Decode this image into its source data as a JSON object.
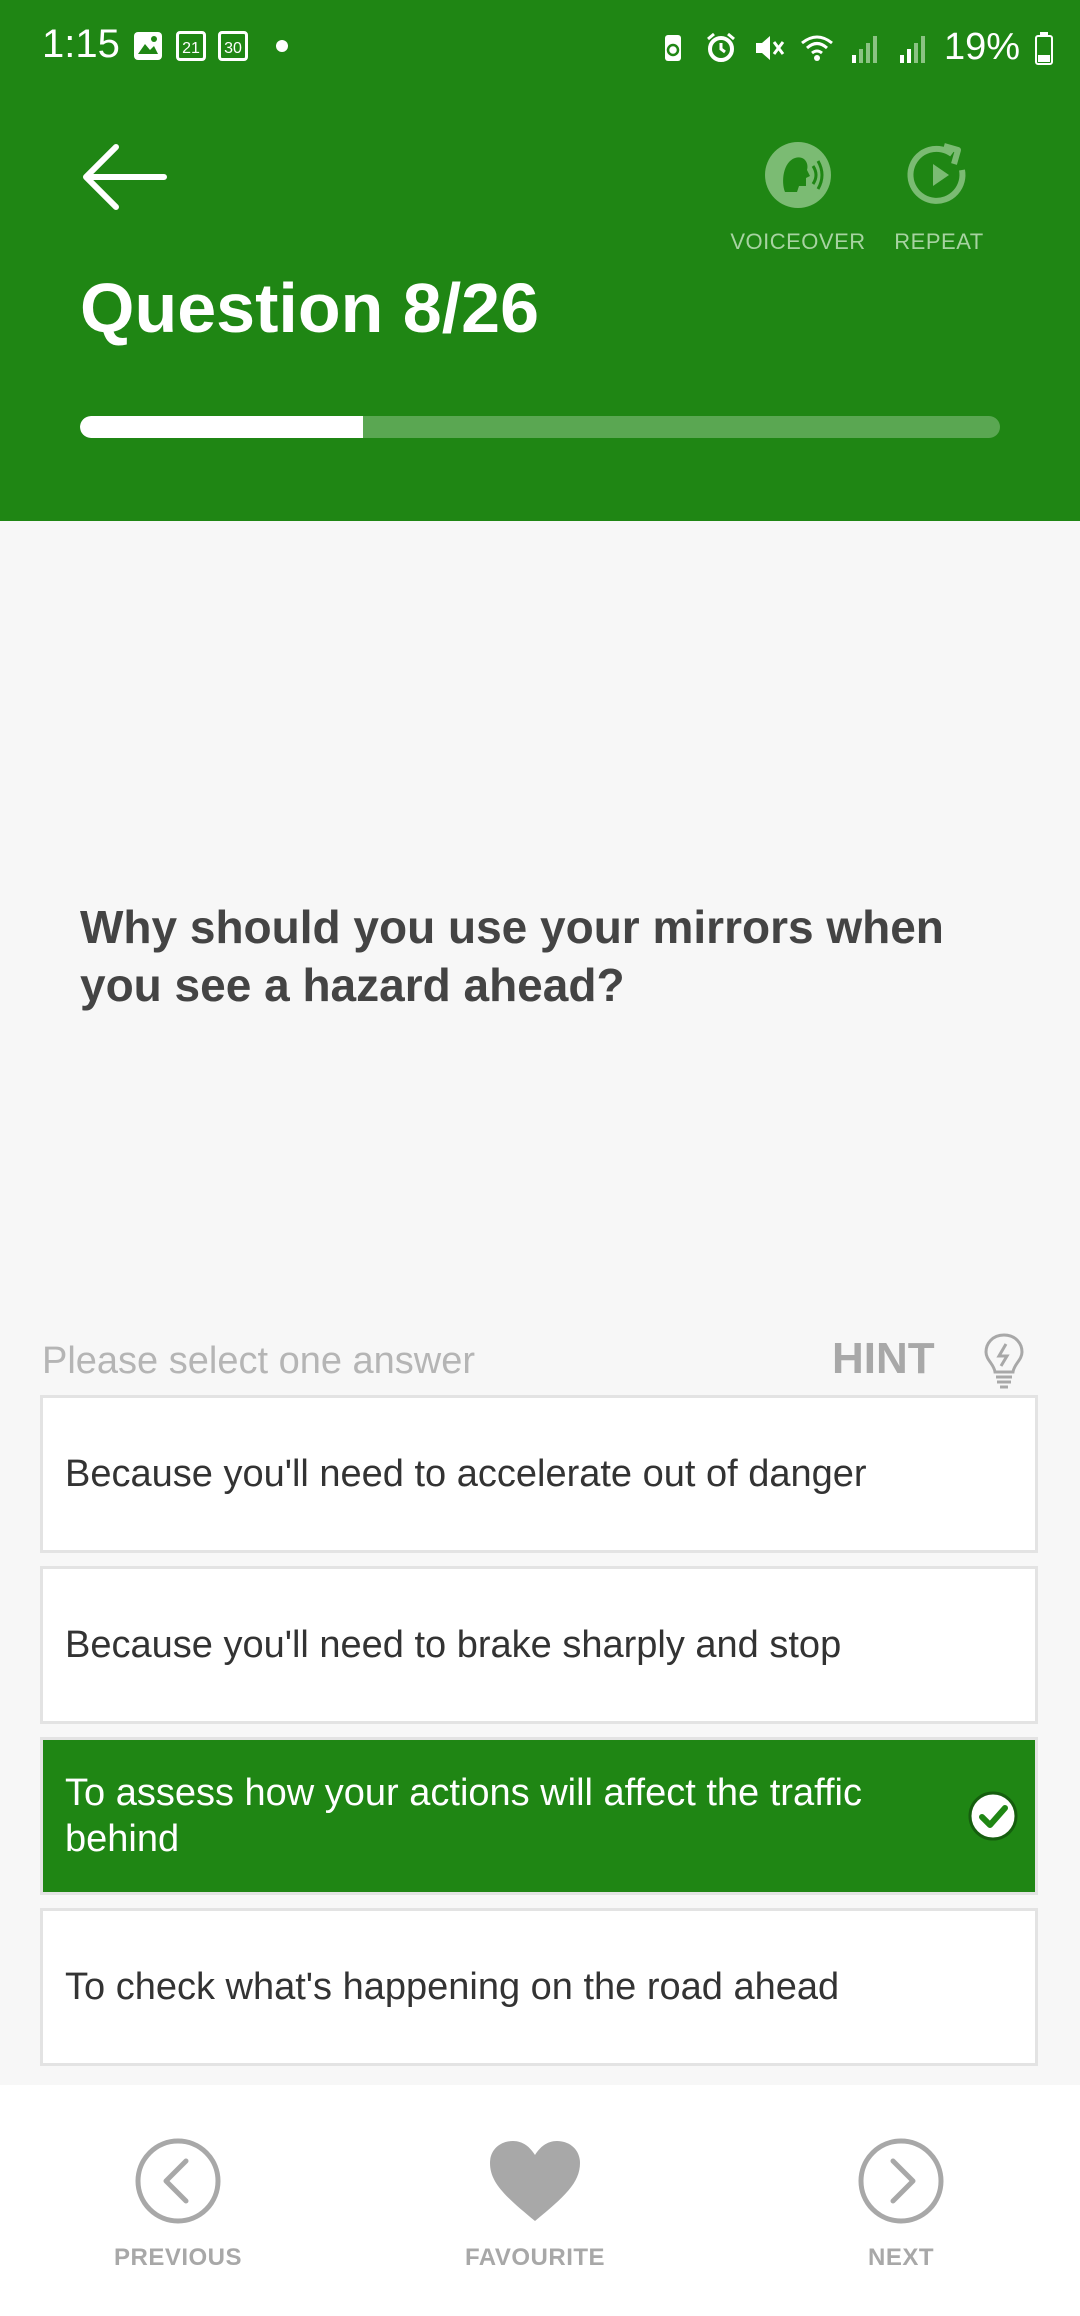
{
  "status_bar": {
    "time": "1:15",
    "calendar_day_1": "21",
    "calendar_day_2": "30",
    "battery": "19%"
  },
  "header": {
    "title": "Question 8/26",
    "voiceover_label": "VOICEOVER",
    "repeat_label": "REPEAT",
    "progress_fraction": 0.3077
  },
  "question": {
    "text": "Why should you use your mirrors when you see a hazard ahead?"
  },
  "answers": {
    "prompt": "Please select one answer",
    "hint_label": "HINT",
    "options": [
      {
        "text": "Because you'll need to accelerate out of danger",
        "selected": false
      },
      {
        "text": "Because you'll need to brake sharply and stop",
        "selected": false
      },
      {
        "text": "To assess how your actions will affect the traffic behind",
        "selected": true
      },
      {
        "text": "To check what's happening on the road ahead",
        "selected": false
      }
    ]
  },
  "bottom_nav": {
    "previous_label": "PREVIOUS",
    "favourite_label": "FAVOURITE",
    "next_label": "NEXT"
  },
  "colors": {
    "brand_green": "#1f8614",
    "muted_gray": "#a8a8a8"
  }
}
